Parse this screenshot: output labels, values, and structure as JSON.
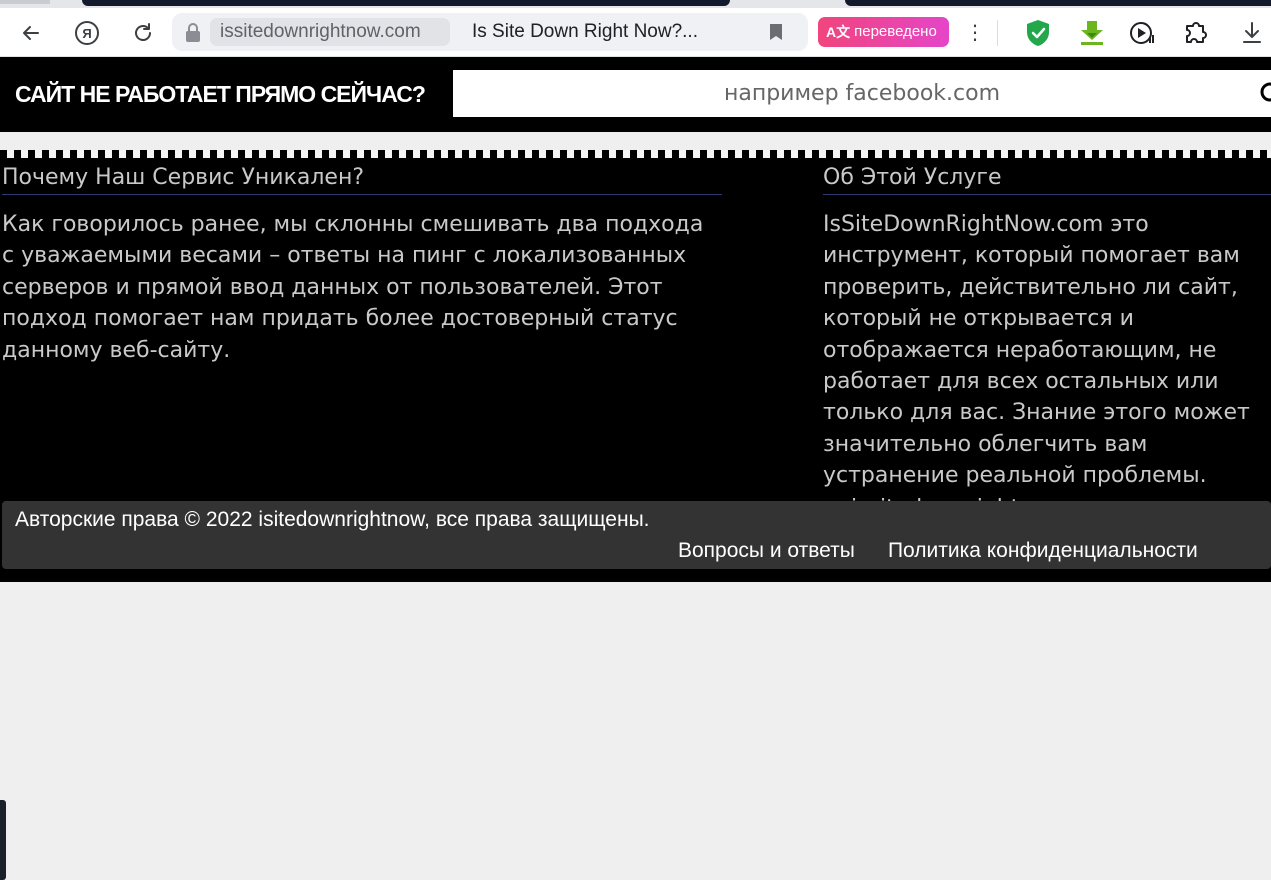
{
  "browser": {
    "address_domain": "issitedownrightnow.com",
    "tab_title": "Is Site Down Right Now?...",
    "translated_badge": "переведено",
    "menu_glyph": "⋮",
    "icons": [
      "back-arrow-icon",
      "yandex-logo-icon",
      "reload-icon",
      "lock-icon",
      "bookmark-icon",
      "translate-icon",
      "adguard-shield-icon",
      "download-manager-icon",
      "media-play-icon",
      "puzzle-extensions-icon",
      "download-icon"
    ],
    "colors": {
      "translated_gradient_start": "#f0457d",
      "translated_gradient_end": "#e545c8",
      "shield": "#22a74a",
      "download_arrow": "#6bb61f"
    }
  },
  "site": {
    "brand": "САЙТ НЕ РАБОТАЕТ ПРЯМО СЕЙЧАС?",
    "search_placeholder": "например facebook.com",
    "colors": {
      "header_bg": "#000000",
      "heading_rule": "#2e3a73",
      "footer_bg": "#333333"
    }
  },
  "main": {
    "left": {
      "heading": "Почему Наш Сервис Уникален?",
      "body": "Как говорилось ранее, мы склонны смешивать два подхода с уважаемыми весами – ответы на пинг с локализованных серверов и прямой ввод данных от пользователей. Этот подход помогает нам придать более достоверный статус данному веб-сайту."
    },
    "right": {
      "heading": "Об Этой Услуге",
      "body": "IsSiteDownRightNow.com это инструмент, который помогает вам проверить, действительно ли сайт, который не открывается и отображается неработающим, не работает для всех остальных или только для вас. Знание этого может значительно облегчить вам устранение реальной проблемы.",
      "skype_name": "issitedownrightnow"
    }
  },
  "footer": {
    "copyright": "Авторские права © 2022 isitedownrightnow, все права защищены.",
    "links": [
      "Вопросы и ответы",
      "Политика конфиденциальности"
    ]
  }
}
